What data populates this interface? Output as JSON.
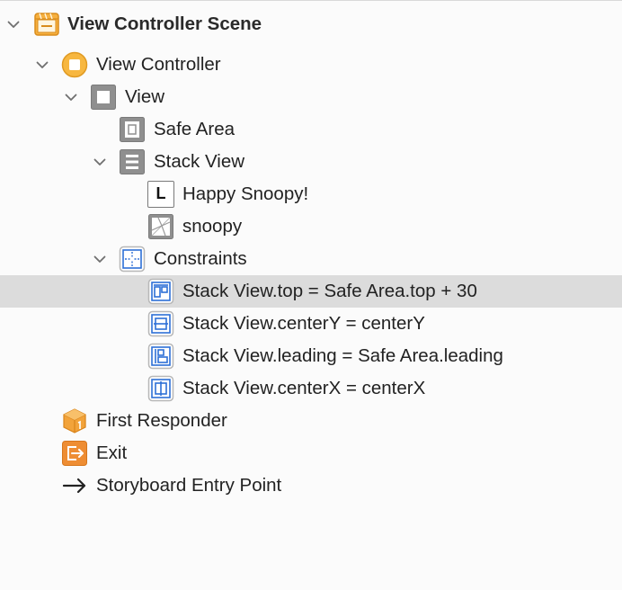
{
  "outline": {
    "scene_title": "View Controller Scene",
    "items": {
      "view_controller": "View Controller",
      "view": "View",
      "safe_area": "Safe Area",
      "stack_view": "Stack View",
      "label_happy_snoopy": "Happy Snoopy!",
      "image_snoopy": "snoopy",
      "constraints": "Constraints",
      "constraint_top": "Stack View.top = Safe Area.top + 30",
      "constraint_center_y": "Stack View.centerY = centerY",
      "constraint_leading": "Stack View.leading = Safe Area.leading",
      "constraint_center_x": "Stack View.centerX = centerX",
      "first_responder": "First Responder",
      "exit": "Exit",
      "storyboard_entry_point": "Storyboard Entry Point"
    },
    "label_icon_text": "L",
    "selected_item": "constraint_top",
    "icons": {
      "scene": "scene-icon",
      "view_controller": "view-controller-icon",
      "view": "view-icon",
      "safe_area": "safe-area-icon",
      "stack_view": "stack-view-icon",
      "label": "label-icon",
      "image": "image-icon",
      "constraints": "constraints-icon",
      "constraint": "constraint-icon",
      "first_responder": "first-responder-icon",
      "exit": "exit-icon",
      "entry_point": "arrow-right-icon"
    },
    "colors": {
      "background": "#fbfbfb",
      "selection": "#dcdcdc",
      "accent_orange": "#f3a53a",
      "constraint_blue": "#2d6fd6",
      "view_gray": "#8a8a8a",
      "text": "#222222"
    }
  }
}
